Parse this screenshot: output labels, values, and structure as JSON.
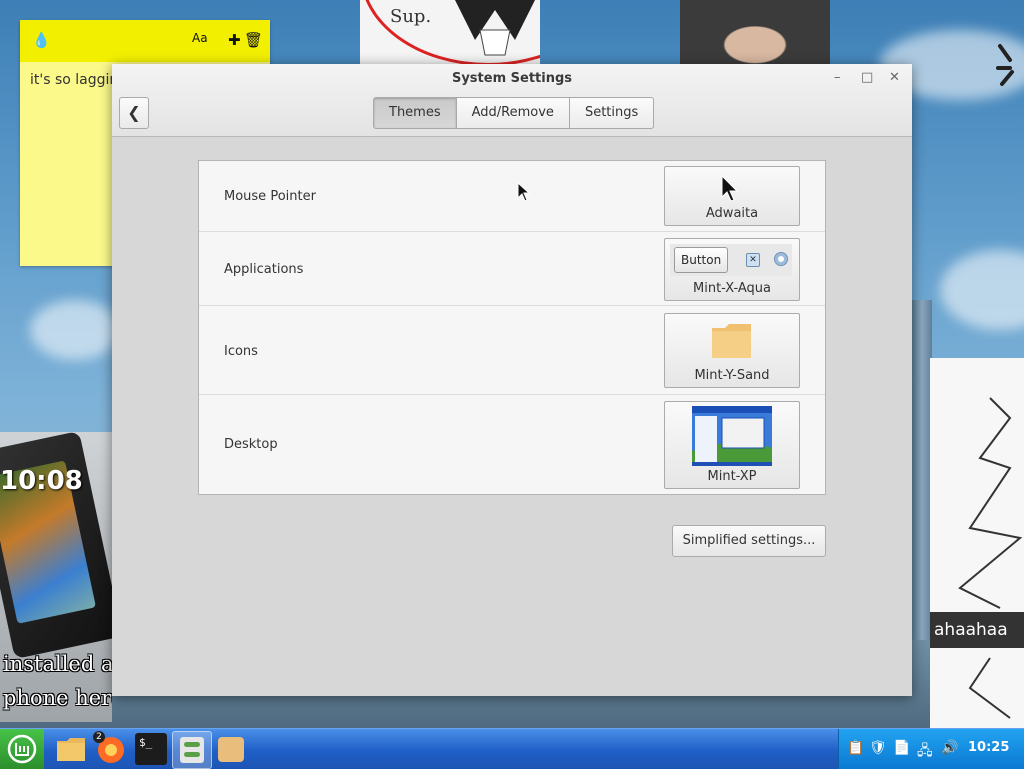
{
  "desktop": {
    "sticky_note": {
      "text": "it's so lagging"
    },
    "phone_ad": {
      "clock": "10:08",
      "caption_line1": "installed a gi",
      "caption_line2": "phone here"
    },
    "sketch_tag": "ahaahaa",
    "doodle_text": "Sup."
  },
  "window": {
    "title": "System Settings",
    "controls": {
      "minimize": "–",
      "maximize": "□",
      "close": "✕"
    },
    "back_glyph": "❮",
    "tabs": [
      {
        "label": "Themes",
        "active": true
      },
      {
        "label": "Add/Remove",
        "active": false
      },
      {
        "label": "Settings",
        "active": false
      }
    ],
    "rows": [
      {
        "label": "Mouse Pointer",
        "value": "Adwaita"
      },
      {
        "label": "Applications",
        "value": "Mint-X-Aqua",
        "preview_button": "Button"
      },
      {
        "label": "Icons",
        "value": "Mint-Y-Sand"
      },
      {
        "label": "Desktop",
        "value": "Mint-XP"
      }
    ],
    "simplified_button": "Simplified settings..."
  },
  "taskbar": {
    "notification_badge": "2",
    "terminal_prompt": "$_",
    "clock": "10:25"
  },
  "colors": {
    "taskbar": "#1f5fc7",
    "tray": "#0b79d2",
    "menu_button": "#2b8f2b",
    "sticky_bar": "#f2f000",
    "sticky_body": "#fbf98a"
  }
}
